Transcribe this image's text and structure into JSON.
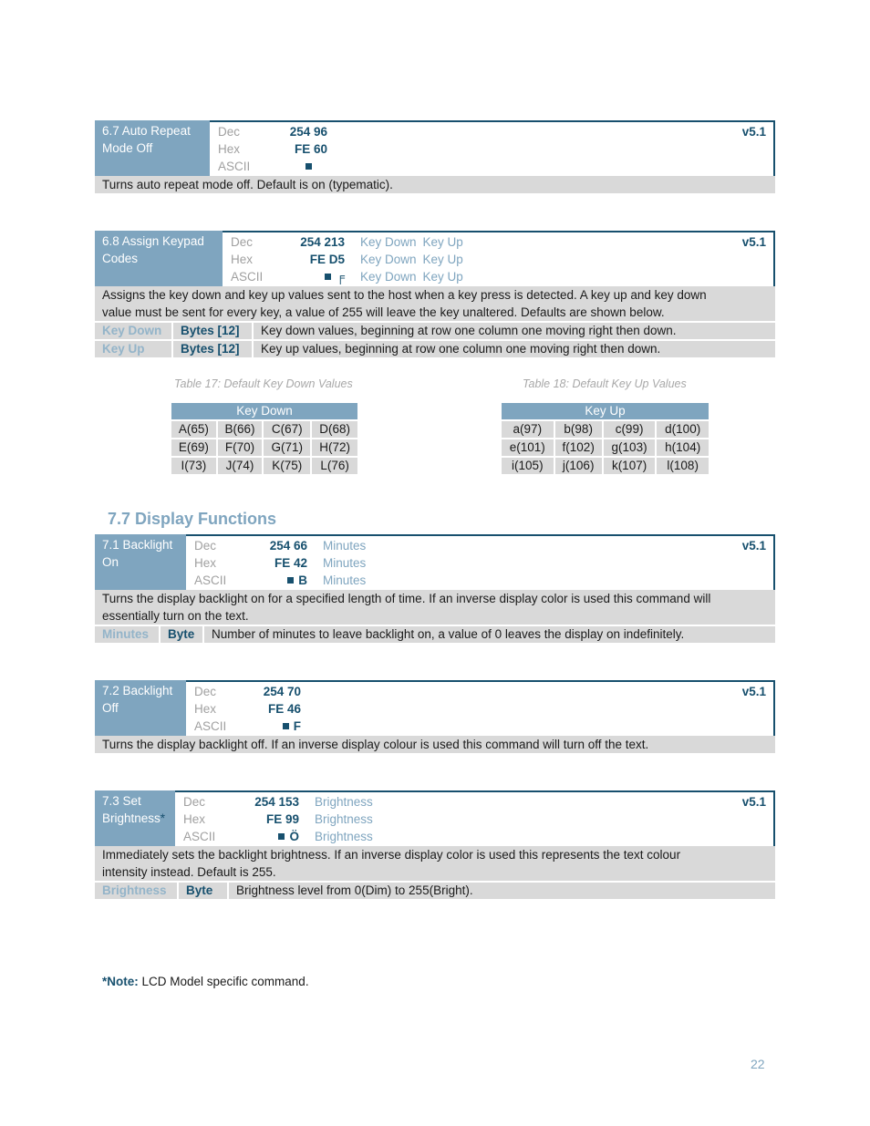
{
  "commands": [
    {
      "title": "6.7 Auto Repeat Mode Off",
      "title_lines": [
        "6.7 Auto Repeat",
        "Mode Off"
      ],
      "version": "v5.1",
      "rows": [
        {
          "label": "Dec",
          "value": "254 96",
          "params": []
        },
        {
          "label": "Hex",
          "value": "FE 60",
          "params": []
        },
        {
          "label": "ASCII",
          "value": "",
          "params": []
        }
      ],
      "description_lines": [
        "Turns auto repeat mode off.  Default is on (typematic)."
      ],
      "parameters": []
    },
    {
      "title": "6.8 Assign Keypad Codes",
      "title_lines": [
        "6.8 Assign Keypad",
        "Codes"
      ],
      "version": "v5.1",
      "rows": [
        {
          "label": "Dec",
          "value": "254 213",
          "params": [
            "Key Down",
            "Key Up"
          ]
        },
        {
          "label": "Hex",
          "value": "FE D5",
          "params": [
            "Key Down",
            "Key Up"
          ]
        },
        {
          "label": "ASCII",
          "value": "╒",
          "params": [
            "Key Down",
            "Key Up"
          ]
        }
      ],
      "description_lines": [
        "Assigns the key down and key up values sent to the host when a key press is detected.  A key up and key down",
        "value must be sent for every key, a value of 255 will leave the key unaltered.  Defaults are shown below."
      ],
      "parameters": [
        {
          "name": "Key Down",
          "type": "Bytes [12]",
          "description": "Key down values, beginning at row one column one moving right then down."
        },
        {
          "name": "Key Up",
          "type": "Bytes [12]",
          "description": "Key up values, beginning at row one column one moving right then down."
        }
      ]
    },
    {
      "title": "7.1 Backlight On",
      "title_lines": [
        "7.1 Backlight",
        "On"
      ],
      "version": "v5.1",
      "rows": [
        {
          "label": "Dec",
          "value": "254 66",
          "params": [
            "Minutes"
          ]
        },
        {
          "label": "Hex",
          "value": "FE 42",
          "params": [
            "Minutes"
          ]
        },
        {
          "label": "ASCII",
          "value": "B",
          "params": [
            "Minutes"
          ]
        }
      ],
      "description_lines": [
        "Turns the display backlight on for a specified length of time.  If an inverse display color is used this command will",
        "essentially turn on the text."
      ],
      "parameters": [
        {
          "name": "Minutes",
          "type": "Byte",
          "description": "Number of minutes to leave backlight on, a value of 0 leaves the display on indefinitely."
        }
      ]
    },
    {
      "title": "7.2 Backlight Off",
      "title_lines": [
        "7.2 Backlight",
        "Off"
      ],
      "version": "v5.1",
      "rows": [
        {
          "label": "Dec",
          "value": "254 70",
          "params": []
        },
        {
          "label": "Hex",
          "value": "FE 46",
          "params": []
        },
        {
          "label": "ASCII",
          "value": "F",
          "params": []
        }
      ],
      "description_lines": [
        "Turns the display backlight off.  If an inverse display colour is used this command will turn off the text."
      ],
      "parameters": []
    },
    {
      "title": "7.3 Set Brightness*",
      "title_lines": [
        "7.3 Set",
        "Brightness"
      ],
      "title_marker": "*",
      "version": "v5.1",
      "rows": [
        {
          "label": "Dec",
          "value": "254 153",
          "params": [
            "Brightness"
          ]
        },
        {
          "label": "Hex",
          "value": "FE 99",
          "params": [
            "Brightness"
          ]
        },
        {
          "label": "ASCII",
          "value": "Ö",
          "params": [
            "Brightness"
          ]
        }
      ],
      "description_lines": [
        "Immediately sets the backlight brightness.  If an inverse display color is used this represents the text colour",
        "intensity instead.  Default is 255."
      ],
      "parameters": [
        {
          "name": "Brightness",
          "type": "Byte",
          "description": "Brightness level from 0(Dim) to 255(Bright)."
        }
      ]
    }
  ],
  "tables": {
    "key_down": {
      "caption": "Table 17: Default Key Down Values",
      "header": "Key Down",
      "rows": [
        [
          "A(65)",
          "B(66)",
          "C(67)",
          "D(68)"
        ],
        [
          "E(69)",
          "F(70)",
          "G(71)",
          "H(72)"
        ],
        [
          "I(73)",
          "J(74)",
          "K(75)",
          "L(76)"
        ]
      ]
    },
    "key_up": {
      "caption": "Table 18: Default Key Up Values",
      "header": "Key Up",
      "rows": [
        [
          "a(97)",
          "b(98)",
          "c(99)",
          "d(100)"
        ],
        [
          "e(101)",
          "f(102)",
          "g(103)",
          "h(104)"
        ],
        [
          "i(105)",
          "j(106)",
          "k(107)",
          "l(108)"
        ]
      ]
    }
  },
  "section_title": "7.7 Display Functions",
  "note": {
    "label": "*Note:",
    "text": " LCD Model specific command."
  },
  "page_number": "22",
  "colors": {
    "accent_dark": "#17506e",
    "accent_light": "#7fa5bf",
    "row_background": "#d9d9d9"
  }
}
